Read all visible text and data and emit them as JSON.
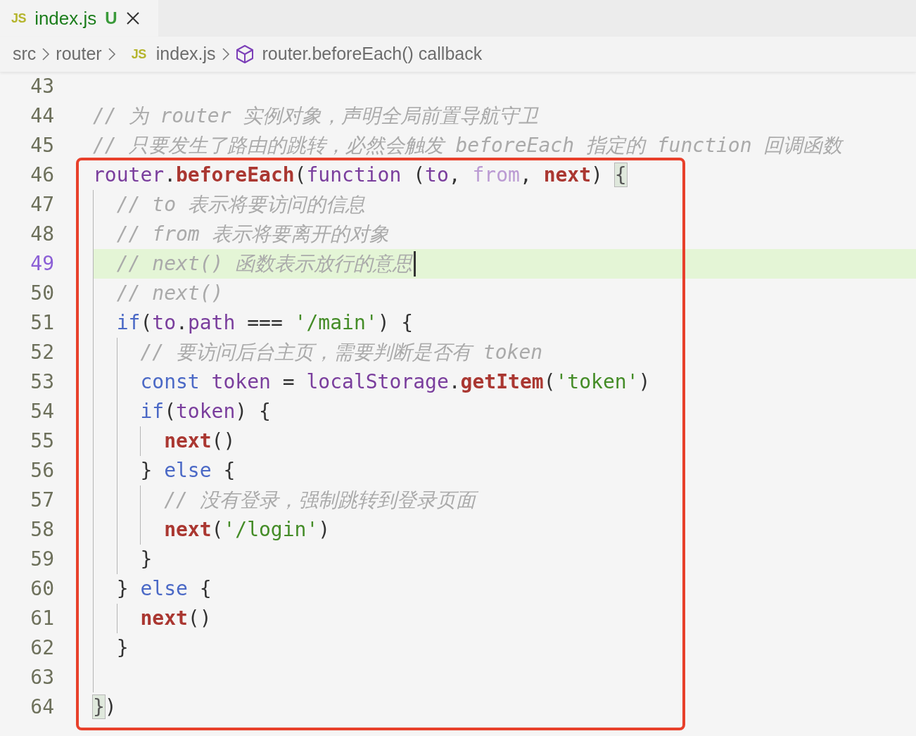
{
  "tab": {
    "icon_text": "JS",
    "title": "index.js",
    "badge": "U",
    "selected": true
  },
  "breadcrumb": [
    {
      "kind": "folder",
      "text": "src"
    },
    {
      "kind": "folder",
      "text": "router"
    },
    {
      "kind": "file",
      "icon_text": "JS",
      "text": "index.js"
    },
    {
      "kind": "symbol",
      "text": "router.beforeEach() callback"
    }
  ],
  "lines": [
    {
      "number": "43",
      "active": false
    },
    {
      "number": "44",
      "active": false,
      "tokens": [
        {
          "kind": "comment",
          "text": "// 为 router 实例对象，声明全局前置导航守卫"
        }
      ]
    },
    {
      "number": "45",
      "active": false,
      "tokens": [
        {
          "kind": "comment",
          "text": "// 只要发生了路由的跳转，必然会触发 beforeEach 指定的 function 回调函数"
        }
      ]
    },
    {
      "number": "46",
      "active": false,
      "tokens": [
        {
          "kind": "variable",
          "text": "router"
        },
        {
          "kind": "punctuation",
          "text": "."
        },
        {
          "kind": "function",
          "text": "beforeEach"
        },
        {
          "kind": "punctuation",
          "text": "("
        },
        {
          "kind": "variable",
          "text": "function"
        },
        {
          "kind": "punctuation",
          "text": " ("
        },
        {
          "kind": "variable",
          "text": "to"
        },
        {
          "kind": "punctuation",
          "text": ", "
        },
        {
          "kind": "unused",
          "text": "from"
        },
        {
          "kind": "punctuation",
          "text": ", "
        },
        {
          "kind": "function",
          "text": "next"
        },
        {
          "kind": "punctuation",
          "text": ") "
        },
        {
          "kind": "bracket",
          "text": "{"
        }
      ]
    },
    {
      "number": "47",
      "active": false,
      "tokens": [
        {
          "kind": "comment",
          "text": "  // to 表示将要访问的信息"
        }
      ]
    },
    {
      "number": "48",
      "active": false,
      "tokens": [
        {
          "kind": "comment",
          "text": "  // from 表示将要离开的对象"
        }
      ]
    },
    {
      "number": "49",
      "active": true,
      "tokens": [
        {
          "kind": "comment",
          "text": "  // next() 函数表示放行的意思"
        }
      ]
    },
    {
      "number": "50",
      "active": false,
      "tokens": [
        {
          "kind": "comment",
          "text": "  // next()"
        }
      ]
    },
    {
      "number": "51",
      "active": false,
      "tokens": [
        {
          "kind": "keyword",
          "text": "  if"
        },
        {
          "kind": "punctuation",
          "text": "("
        },
        {
          "kind": "variable",
          "text": "to"
        },
        {
          "kind": "punctuation",
          "text": "."
        },
        {
          "kind": "variable",
          "text": "path"
        },
        {
          "kind": "punctuation",
          "text": " === "
        },
        {
          "kind": "string",
          "text": "'/main'"
        },
        {
          "kind": "punctuation",
          "text": ") {"
        }
      ]
    },
    {
      "number": "52",
      "active": false,
      "tokens": [
        {
          "kind": "comment",
          "text": "    // 要访问后台主页，需要判断是否有 token"
        }
      ]
    },
    {
      "number": "53",
      "active": false,
      "tokens": [
        {
          "kind": "keyword",
          "text": "    const"
        },
        {
          "kind": "variable",
          "text": " token"
        },
        {
          "kind": "punctuation",
          "text": " = "
        },
        {
          "kind": "variable",
          "text": "localStorage"
        },
        {
          "kind": "punctuation",
          "text": "."
        },
        {
          "kind": "function",
          "text": "getItem"
        },
        {
          "kind": "punctuation",
          "text": "("
        },
        {
          "kind": "string",
          "text": "'token'"
        },
        {
          "kind": "punctuation",
          "text": ")"
        }
      ]
    },
    {
      "number": "54",
      "active": false,
      "tokens": [
        {
          "kind": "keyword",
          "text": "    if"
        },
        {
          "kind": "punctuation",
          "text": "("
        },
        {
          "kind": "variable",
          "text": "token"
        },
        {
          "kind": "punctuation",
          "text": ") {"
        }
      ]
    },
    {
      "number": "55",
      "active": false,
      "tokens": [
        {
          "kind": "function",
          "text": "      next"
        },
        {
          "kind": "punctuation",
          "text": "()"
        }
      ]
    },
    {
      "number": "56",
      "active": false,
      "tokens": [
        {
          "kind": "punctuation",
          "text": "    } "
        },
        {
          "kind": "keyword",
          "text": "else"
        },
        {
          "kind": "punctuation",
          "text": " {"
        }
      ]
    },
    {
      "number": "57",
      "active": false,
      "tokens": [
        {
          "kind": "comment",
          "text": "      // 没有登录，强制跳转到登录页面"
        }
      ]
    },
    {
      "number": "58",
      "active": false,
      "tokens": [
        {
          "kind": "function",
          "text": "      next"
        },
        {
          "kind": "punctuation",
          "text": "("
        },
        {
          "kind": "string",
          "text": "'/login'"
        },
        {
          "kind": "punctuation",
          "text": ")"
        }
      ]
    },
    {
      "number": "59",
      "active": false,
      "tokens": [
        {
          "kind": "punctuation",
          "text": "    }"
        }
      ]
    },
    {
      "number": "60",
      "active": false,
      "tokens": [
        {
          "kind": "punctuation",
          "text": "  } "
        },
        {
          "kind": "keyword",
          "text": "else"
        },
        {
          "kind": "punctuation",
          "text": " {"
        }
      ]
    },
    {
      "number": "61",
      "active": false,
      "tokens": [
        {
          "kind": "function",
          "text": "    next"
        },
        {
          "kind": "punctuation",
          "text": "()"
        }
      ]
    },
    {
      "number": "62",
      "active": false,
      "tokens": [
        {
          "kind": "punctuation",
          "text": "  }"
        }
      ]
    },
    {
      "number": "63",
      "active": false
    },
    {
      "number": "64",
      "active": false,
      "tokens": [
        {
          "kind": "bracket",
          "text": "}"
        },
        {
          "kind": "punctuation",
          "text": ")"
        }
      ]
    }
  ]
}
